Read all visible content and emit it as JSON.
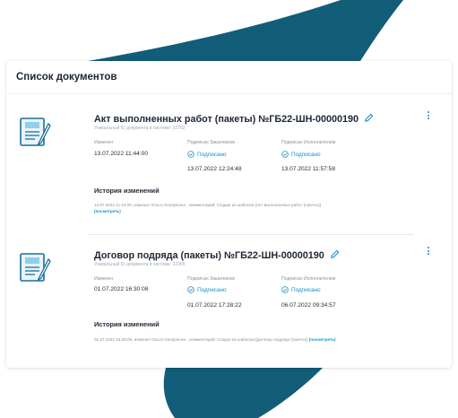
{
  "colors": {
    "accent": "#1b8fc6",
    "brand_dark": "#125d77"
  },
  "list": {
    "title": "Список документов"
  },
  "documents": [
    {
      "icon": "document-icon",
      "title": "Акт выполненных работ (пакеты) №ГБ22-ШН-00000190",
      "uid": "Уникальный ID документа в системе: 22762",
      "changed_label": "Изменен",
      "changed_value": "13.07.2022 11:44:00",
      "customer_label": "Подписан Заказчиком",
      "customer_status": "Подписано",
      "customer_date": "13.07.2022 12:24:48",
      "executor_label": "Подписан Исполнителем",
      "executor_status": "Подписано",
      "executor_date": "13.07.2022 11:57:58",
      "history_title": "История изменений",
      "history_text": "13.07.2022 11:44:00, изменил Ольга Онопрієнко , комментарий: Создан из шаблона [Акт выполненных работ (пакеты)]",
      "history_link": "(посмотреть)"
    },
    {
      "icon": "document-icon",
      "title": "Договор подряда (пакеты) №ГБ22-ШН-00000190",
      "uid": "Уникальный ID документа в системе: 22365",
      "changed_label": "Изменен",
      "changed_value": "01.07.2022 16:30:08",
      "customer_label": "Подписан Заказчиком",
      "customer_status": "Подписано",
      "customer_date": "01.07.2022 17:28:22",
      "executor_label": "Подписан Исполнителем",
      "executor_status": "Подписано",
      "executor_date": "06.07.2022 09:34:57",
      "history_title": "История изменений",
      "history_text": "01.07.2022 16:30:08, изменил Ольга Онопрієнко , комментарий: Создан из шаблона [Договор подряда (пакеты)]",
      "history_link": "(посмотреть)"
    }
  ]
}
